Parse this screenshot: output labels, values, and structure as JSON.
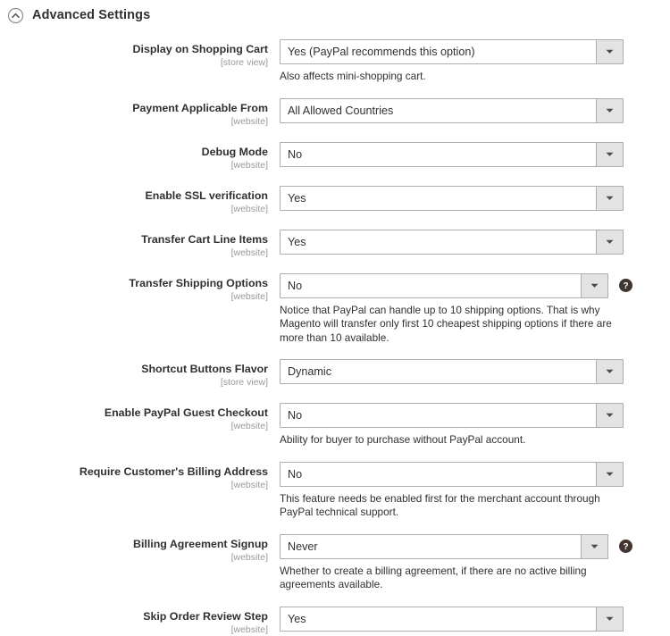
{
  "section": {
    "title": "Advanced Settings",
    "collapse_icon": "chevron-up-circle-icon"
  },
  "scopes": {
    "store_view": "[store view]",
    "website": "[website]"
  },
  "icons": {
    "dropdown": "chevron-down-icon",
    "help": "question-mark-circle-icon"
  },
  "fields": [
    {
      "label": "Display on Shopping Cart",
      "scope": "[store view]",
      "value": "Yes (PayPal recommends this option)",
      "note": "Also affects mini-shopping cart.",
      "help": false
    },
    {
      "label": "Payment Applicable From",
      "scope": "[website]",
      "value": "All Allowed Countries",
      "note": "",
      "help": false
    },
    {
      "label": "Debug Mode",
      "scope": "[website]",
      "value": "No",
      "note": "",
      "help": false
    },
    {
      "label": "Enable SSL verification",
      "scope": "[website]",
      "value": "Yes",
      "note": "",
      "help": false
    },
    {
      "label": "Transfer Cart Line Items",
      "scope": "[website]",
      "value": "Yes",
      "note": "",
      "help": false
    },
    {
      "label": "Transfer Shipping Options",
      "scope": "[website]",
      "value": "No",
      "note": "Notice that PayPal can handle up to 10 shipping options. That is why Magento will transfer only first 10 cheapest shipping options if there are more than 10 available.",
      "help": true
    },
    {
      "label": "Shortcut Buttons Flavor",
      "scope": "[store view]",
      "value": "Dynamic",
      "note": "",
      "help": false
    },
    {
      "label": "Enable PayPal Guest Checkout",
      "scope": "[website]",
      "value": "No",
      "note": "Ability for buyer to purchase without PayPal account.",
      "help": false
    },
    {
      "label": "Require Customer's Billing Address",
      "scope": "[website]",
      "value": "No",
      "note": "This feature needs be enabled first for the merchant account through PayPal technical support.",
      "help": false
    },
    {
      "label": "Billing Agreement Signup",
      "scope": "[website]",
      "value": "Never",
      "note": "Whether to create a billing agreement, if there are no active billing agreements available.",
      "help": true
    },
    {
      "label": "Skip Order Review Step",
      "scope": "[website]",
      "value": "Yes",
      "note": "",
      "help": false
    }
  ],
  "colors": {
    "text": "#303030",
    "scope_text": "#999999",
    "border": "#adadad",
    "arrow_bg": "#e3e3e3",
    "help_icon": "#41362f"
  }
}
